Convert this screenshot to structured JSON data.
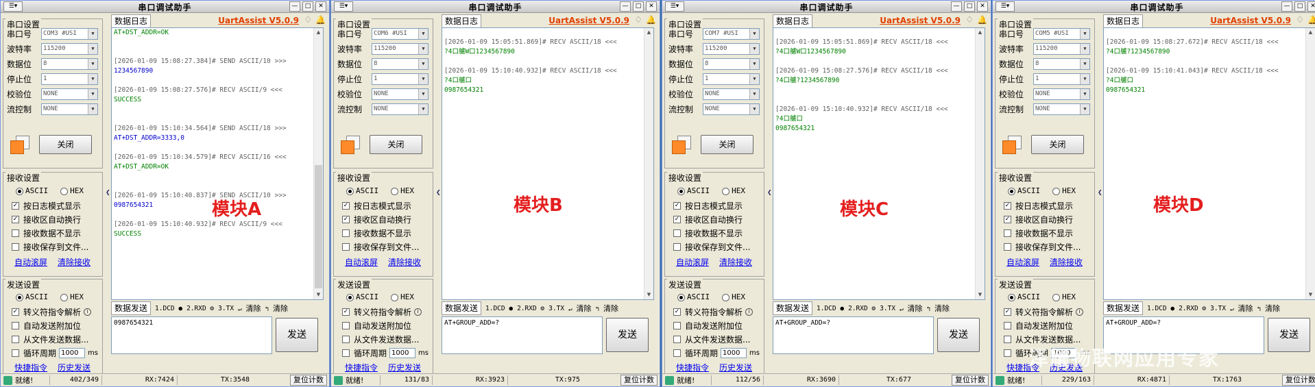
{
  "app_title": "串口调试助手",
  "brand": "UartAssist V5.0.9",
  "labels": {
    "serial_settings": "串口设置",
    "port": "串口号",
    "baud": "波特率",
    "databits": "数据位",
    "stopbits": "停止位",
    "parity": "校验位",
    "flow": "流控制",
    "close": "关闭",
    "recv_settings": "接收设置",
    "send_settings": "发送设置",
    "ascii": "ASCII",
    "hex": "HEX",
    "log_mode": "按日志模式显示",
    "auto_wrap": "接收区自动换行",
    "no_show": "接收数据不显示",
    "save_file": "接收保存到文件...",
    "auto_scroll": "自动滚屏",
    "clear_recv": "清除接收",
    "escape": "转义符指令解析",
    "auto_append": "自动发送附加位",
    "file_send": "从文件发送数据...",
    "cycle": "循环周期",
    "ms": "ms",
    "shortcut": "快捷指令",
    "history": "历史发送",
    "log_tab": "数据日志",
    "send_tab": "数据发送",
    "dcd": "1.DCD",
    "rxd": "2.RXD",
    "tx3": "3.TX",
    "clear1": "清除",
    "clear2": "清除",
    "send": "发送",
    "ready": "就绪!",
    "reset": "复位计数"
  },
  "windows": [
    {
      "port": "COM3 #USI",
      "baud": "115200",
      "databits": "8",
      "stopbits": "1",
      "parity": "NONE",
      "flow": "NONE",
      "cycle_ms": "1000",
      "module_label": "模块A",
      "send_text": "0987654321",
      "counter": "402/349",
      "rx": "RX:7424",
      "tx": "TX:3548",
      "log": [
        {
          "t": "recv",
          "s": "AT+DST_ADDR=OK"
        },
        {
          "t": "blank",
          "s": ""
        },
        {
          "t": "blank",
          "s": ""
        },
        {
          "t": "meta",
          "s": "[2026-01-09 15:08:27.384]# SEND ASCII/10 >>>"
        },
        {
          "t": "send",
          "s": "1234567890"
        },
        {
          "t": "blank",
          "s": ""
        },
        {
          "t": "meta",
          "s": "[2026-01-09 15:08:27.576]# RECV ASCII/9 <<<"
        },
        {
          "t": "recv",
          "s": "SUCCESS"
        },
        {
          "t": "blank",
          "s": ""
        },
        {
          "t": "blank",
          "s": ""
        },
        {
          "t": "meta",
          "s": "[2026-01-09 15:10:34.564]# SEND ASCII/18 >>>"
        },
        {
          "t": "send",
          "s": "AT+DST_ADDR=3333,0"
        },
        {
          "t": "blank",
          "s": ""
        },
        {
          "t": "meta",
          "s": "[2026-01-09 15:10:34.579]# RECV ASCII/16 <<<"
        },
        {
          "t": "recv",
          "s": "AT+DST_ADDR=OK"
        },
        {
          "t": "blank",
          "s": ""
        },
        {
          "t": "blank",
          "s": ""
        },
        {
          "t": "meta",
          "s": "[2026-01-09 15:10:40.837]# SEND ASCII/10 >>>"
        },
        {
          "t": "send",
          "s": "0987654321"
        },
        {
          "t": "blank",
          "s": ""
        },
        {
          "t": "meta",
          "s": "[2026-01-09 15:10:40.932]# RECV ASCII/9 <<<"
        },
        {
          "t": "recv",
          "s": "SUCCESS"
        }
      ]
    },
    {
      "port": "COM6 #USI",
      "baud": "115200",
      "databits": "8",
      "stopbits": "1",
      "parity": "NONE",
      "flow": "NONE",
      "cycle_ms": "1000",
      "module_label": "模块B",
      "send_text": "AT+GROUP_ADD=?",
      "counter": "131/83",
      "rx": "RX:3923",
      "tx": "TX:975",
      "log": [
        {
          "t": "blank",
          "s": ""
        },
        {
          "t": "meta",
          "s": "[2026-01-09 15:05:51.869]# RECV ASCII/18 <<<"
        },
        {
          "t": "recv",
          "s": "?4口艫W口1234567890"
        },
        {
          "t": "blank",
          "s": ""
        },
        {
          "t": "meta",
          "s": "[2026-01-09 15:10:40.932]# RECV ASCII/18 <<<"
        },
        {
          "t": "recv",
          "s": "?4口艫口"
        },
        {
          "t": "recv",
          "s": "0987654321"
        }
      ]
    },
    {
      "port": "COM7 #USI",
      "baud": "115200",
      "databits": "8",
      "stopbits": "1",
      "parity": "NONE",
      "flow": "NONE",
      "cycle_ms": "1000",
      "module_label": "模块C",
      "send_text": "AT+GROUP_ADD=?",
      "counter": "112/56",
      "rx": "RX:3690",
      "tx": "TX:677",
      "log": [
        {
          "t": "blank",
          "s": ""
        },
        {
          "t": "meta",
          "s": "[2026-01-09 15:05:51.869]# RECV ASCII/18 <<<"
        },
        {
          "t": "recv",
          "s": "?4口艫W口1234567890"
        },
        {
          "t": "blank",
          "s": ""
        },
        {
          "t": "meta",
          "s": "[2026-01-09 15:08:27.576]# RECV ASCII/18 <<<"
        },
        {
          "t": "recv",
          "s": "?4口艫?1234567890"
        },
        {
          "t": "blank",
          "s": ""
        },
        {
          "t": "blank",
          "s": ""
        },
        {
          "t": "meta",
          "s": "[2026-01-09 15:10:40.932]# RECV ASCII/18 <<<"
        },
        {
          "t": "recv",
          "s": "?4口艫口"
        },
        {
          "t": "recv",
          "s": "0987654321"
        }
      ]
    },
    {
      "port": "COM5 #USI",
      "baud": "115200",
      "databits": "8",
      "stopbits": "1",
      "parity": "NONE",
      "flow": "NONE",
      "cycle_ms": "1000",
      "module_label": "模块D",
      "send_text": "AT+GROUP_ADD=?",
      "counter": "229/163",
      "rx": "RX:4871",
      "tx": "TX:1763",
      "log": [
        {
          "t": "blank",
          "s": ""
        },
        {
          "t": "meta",
          "s": "[2026-01-09 15:08:27.672]# RECV ASCII/18 <<<"
        },
        {
          "t": "recv",
          "s": "?4口艫?1234567890"
        },
        {
          "t": "blank",
          "s": ""
        },
        {
          "t": "meta",
          "s": "[2026-01-09 15:10:41.043]# RECV ASCII/18 <<<"
        },
        {
          "t": "recv",
          "s": "?4口艫口"
        },
        {
          "t": "recv",
          "s": "0987654321"
        }
      ]
    }
  ],
  "watermark": "泽耀物联网应用专家"
}
